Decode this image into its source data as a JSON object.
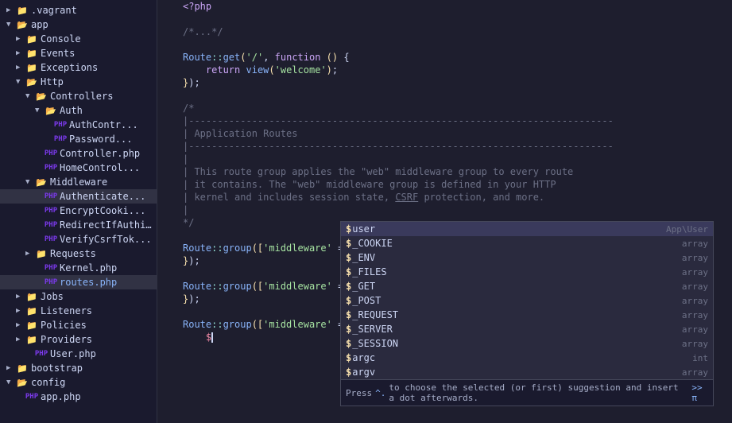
{
  "sidebar": {
    "items": [
      {
        "id": "vagrant",
        "label": ".vagrant",
        "indent": "indent-1",
        "arrow": "closed",
        "icon": "folder",
        "level": 1
      },
      {
        "id": "app",
        "label": "app",
        "indent": "indent-1",
        "arrow": "open",
        "icon": "folder-open",
        "level": 1
      },
      {
        "id": "console",
        "label": "Console",
        "indent": "indent-2",
        "arrow": "closed",
        "icon": "folder",
        "level": 2
      },
      {
        "id": "events",
        "label": "Events",
        "indent": "indent-2",
        "arrow": "closed",
        "icon": "folder",
        "level": 2
      },
      {
        "id": "exceptions",
        "label": "Exceptions",
        "indent": "indent-2",
        "arrow": "closed",
        "icon": "folder",
        "level": 2
      },
      {
        "id": "http",
        "label": "Http",
        "indent": "indent-2",
        "arrow": "open",
        "icon": "folder-open",
        "level": 2
      },
      {
        "id": "controllers",
        "label": "Controllers",
        "indent": "indent-3",
        "arrow": "open",
        "icon": "folder-open",
        "level": 3
      },
      {
        "id": "auth",
        "label": "Auth",
        "indent": "indent-4",
        "arrow": "open",
        "icon": "folder-open",
        "level": 4
      },
      {
        "id": "authcontr",
        "label": "AuthContr...",
        "indent": "indent-5",
        "arrow": "",
        "icon": "php",
        "level": 5
      },
      {
        "id": "password",
        "label": "Password...",
        "indent": "indent-5",
        "arrow": "",
        "icon": "php",
        "level": 5
      },
      {
        "id": "controllerphp",
        "label": "Controller.php",
        "indent": "indent-4",
        "arrow": "",
        "icon": "php",
        "level": 4
      },
      {
        "id": "homecontrol",
        "label": "HomeControl...",
        "indent": "indent-4",
        "arrow": "",
        "icon": "php",
        "level": 4
      },
      {
        "id": "middleware",
        "label": "Middleware",
        "indent": "indent-3",
        "arrow": "open",
        "icon": "folder-open",
        "level": 3
      },
      {
        "id": "authenticate",
        "label": "Authenticate...",
        "indent": "indent-4",
        "arrow": "",
        "icon": "php",
        "level": 4,
        "selected": true
      },
      {
        "id": "encryptcooki",
        "label": "EncryptCooki...",
        "indent": "indent-4",
        "arrow": "",
        "icon": "php",
        "level": 4
      },
      {
        "id": "redirectifauthi",
        "label": "RedirectIfAuthi...",
        "indent": "indent-4",
        "arrow": "",
        "icon": "php",
        "level": 4
      },
      {
        "id": "verifycsrftok",
        "label": "VerifyCsrfTok...",
        "indent": "indent-4",
        "arrow": "",
        "icon": "php",
        "level": 4
      },
      {
        "id": "requests",
        "label": "Requests",
        "indent": "indent-3",
        "arrow": "closed",
        "icon": "folder",
        "level": 3
      },
      {
        "id": "kernelphp",
        "label": "Kernel.php",
        "indent": "indent-4",
        "arrow": "",
        "icon": "php",
        "level": 4
      },
      {
        "id": "routesphp",
        "label": "routes.php",
        "indent": "indent-4",
        "arrow": "",
        "icon": "php",
        "level": 4,
        "selected2": true
      },
      {
        "id": "jobs",
        "label": "Jobs",
        "indent": "indent-2",
        "arrow": "closed",
        "icon": "folder",
        "level": 2
      },
      {
        "id": "listeners",
        "label": "Listeners",
        "indent": "indent-2",
        "arrow": "closed",
        "icon": "folder",
        "level": 2
      },
      {
        "id": "policies",
        "label": "Policies",
        "indent": "indent-2",
        "arrow": "closed",
        "icon": "folder",
        "level": 2
      },
      {
        "id": "providers",
        "label": "Providers",
        "indent": "indent-2",
        "arrow": "closed",
        "icon": "folder",
        "level": 2
      },
      {
        "id": "userphp",
        "label": "User.php",
        "indent": "indent-3",
        "arrow": "",
        "icon": "php",
        "level": 3
      },
      {
        "id": "bootstrap",
        "label": "bootstrap",
        "indent": "indent-1",
        "arrow": "closed",
        "icon": "folder",
        "level": 1
      },
      {
        "id": "config",
        "label": "config",
        "indent": "indent-1",
        "arrow": "open",
        "icon": "folder-open",
        "level": 1
      },
      {
        "id": "appphp",
        "label": "app.php",
        "indent": "indent-2",
        "arrow": "",
        "icon": "php",
        "level": 2
      }
    ]
  },
  "editor": {
    "lines": [
      {
        "num": "",
        "content": "<?php"
      },
      {
        "num": "",
        "content": ""
      },
      {
        "num": "",
        "content": "/*...*/"
      },
      {
        "num": "",
        "content": ""
      },
      {
        "num": "",
        "content": "Route::get('/', function () {"
      },
      {
        "num": "",
        "content": "    return view('welcome');"
      },
      {
        "num": "",
        "content": "});"
      },
      {
        "num": "",
        "content": ""
      },
      {
        "num": "",
        "content": "/*"
      },
      {
        "num": "",
        "content": "|--------------------------------------------------"
      },
      {
        "num": "",
        "content": "| Application Routes"
      },
      {
        "num": "",
        "content": "|--------------------------------------------------"
      },
      {
        "num": "",
        "content": "|"
      },
      {
        "num": "",
        "content": "| This route group applies the \"web\" middleware group to every route"
      },
      {
        "num": "",
        "content": "| it contains. The \"web\" middleware group is defined in your HTTP"
      },
      {
        "num": "",
        "content": "| kernel and includes session state, CSRF protection, and more."
      },
      {
        "num": "",
        "content": "|"
      },
      {
        "num": "",
        "content": "*/"
      },
      {
        "num": "",
        "content": ""
      },
      {
        "num": "",
        "content": "Route::group(['middleware' => ['web']], function () {"
      },
      {
        "num": "",
        "content": "});"
      },
      {
        "num": "",
        "content": ""
      },
      {
        "num": "",
        "content": "Route::group(['middleware' => ['web']], function () {"
      },
      {
        "num": "",
        "content": "});"
      },
      {
        "num": "",
        "content": ""
      },
      {
        "num": "",
        "content": "Route::group(['middleware' => ['web']], function () {"
      },
      {
        "num": "",
        "content": "    $"
      }
    ]
  },
  "autocomplete": {
    "items": [
      {
        "dollar": "$",
        "name": "user",
        "type": "App\\User",
        "selected": true
      },
      {
        "dollar": "$",
        "name": "_COOKIE",
        "type": "array",
        "selected": false
      },
      {
        "dollar": "$",
        "name": "_ENV",
        "type": "array",
        "selected": false
      },
      {
        "dollar": "$",
        "name": "_FILES",
        "type": "array",
        "selected": false
      },
      {
        "dollar": "$",
        "name": "_GET",
        "type": "array",
        "selected": false
      },
      {
        "dollar": "$",
        "name": "_POST",
        "type": "array",
        "selected": false
      },
      {
        "dollar": "$",
        "name": "_REQUEST",
        "type": "array",
        "selected": false
      },
      {
        "dollar": "$",
        "name": "_SERVER",
        "type": "array",
        "selected": false
      },
      {
        "dollar": "$",
        "name": "_SESSION",
        "type": "array",
        "selected": false
      },
      {
        "dollar": "$",
        "name": "argc",
        "type": "int",
        "selected": false
      },
      {
        "dollar": "$",
        "name": "argv",
        "type": "array",
        "selected": false
      }
    ],
    "hint": "Press ^. to choose the selected (or first) suggestion and insert a dot afterwards.",
    "hint_key": "^.",
    "hint_arrow": ">> π"
  }
}
